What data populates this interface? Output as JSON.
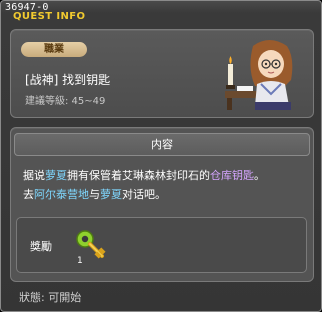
{
  "header": {
    "quest_id": "36947-0",
    "title": "QUEST INFO"
  },
  "quest": {
    "category_badge": "職業",
    "name": "[战神] 找到钥匙",
    "level_range": "建議等級: 45~49"
  },
  "content": {
    "heading": "内容",
    "desc": {
      "p1": "据说",
      "npc1": "萝夏",
      "p2": "拥有保管着艾琳森林封印石的",
      "item": "仓库钥匙",
      "p3": "。",
      "p4": "去",
      "place": "阿尔泰营地",
      "p5": "与",
      "npc2": "萝夏",
      "p6": "对话吧。"
    }
  },
  "reward": {
    "label": "獎勵",
    "quantity": "1",
    "item_icon": "golden-key-icon"
  },
  "status": {
    "text": "狀態:  可開始"
  },
  "colors": {
    "title": "#f1ca2f",
    "highlight_blue": "#7fd8ff",
    "highlight_purple": "#d5a5ff"
  }
}
